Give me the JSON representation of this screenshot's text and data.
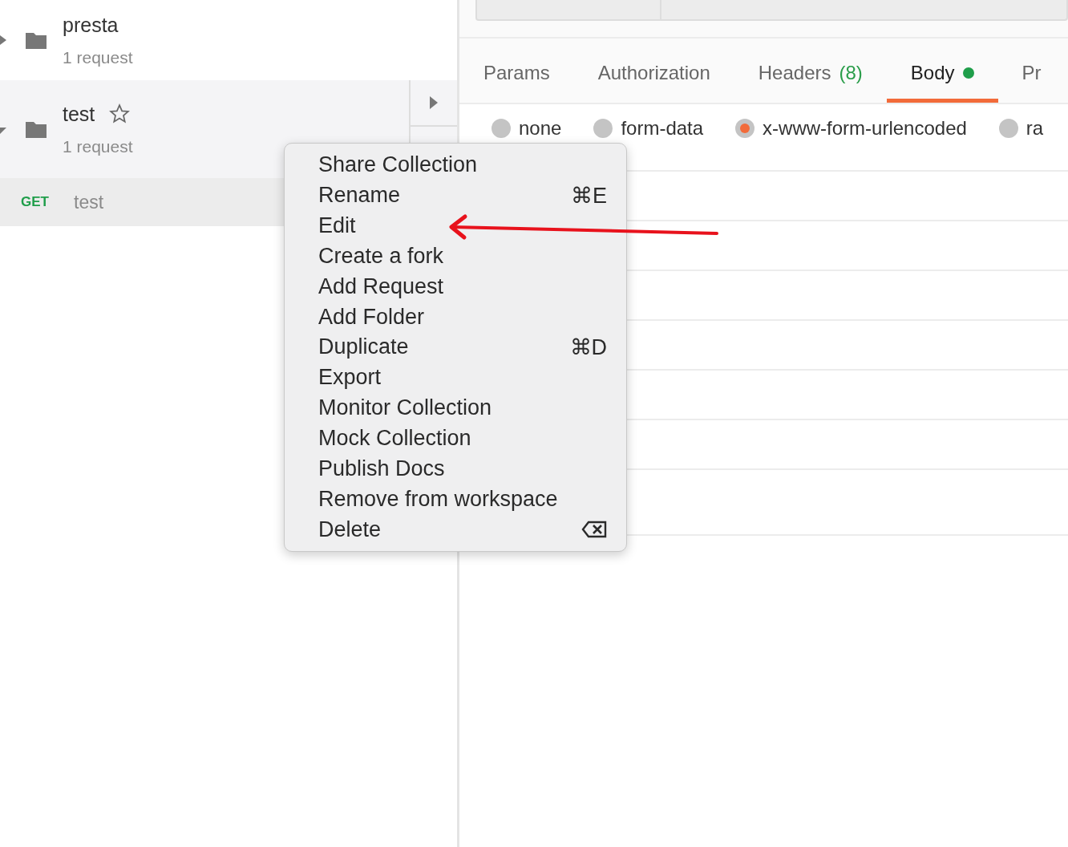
{
  "sidebar": {
    "collections": [
      {
        "name": "presta",
        "count": "1 request",
        "expanded": false,
        "show_star": false
      },
      {
        "name": "test",
        "count": "1 request",
        "expanded": true,
        "show_star": true,
        "children": [
          {
            "method": "GET",
            "name": "test"
          }
        ]
      }
    ]
  },
  "request_tabs": [
    {
      "label": "Params",
      "selected": false
    },
    {
      "label": "Authorization",
      "selected": false
    },
    {
      "label": "Headers",
      "count": "(8)",
      "selected": false
    },
    {
      "label": "Body",
      "selected": true,
      "modified": true
    },
    {
      "label": "Pr",
      "selected": false
    }
  ],
  "body_types": [
    {
      "label": "none",
      "selected": false
    },
    {
      "label": "form-data",
      "selected": false
    },
    {
      "label": "x-www-form-urlencoded",
      "selected": true
    },
    {
      "label": "ra",
      "selected": false
    }
  ],
  "context_menu": [
    {
      "label": "Share Collection",
      "kind": "plain"
    },
    {
      "label": "Rename",
      "kind": "shortcut",
      "shortcut": "⌘E"
    },
    {
      "label": "Edit",
      "kind": "plain"
    },
    {
      "label": "Create a fork",
      "kind": "plain"
    },
    {
      "label": "Add Request",
      "kind": "plain"
    },
    {
      "label": "Add Folder",
      "kind": "plain"
    },
    {
      "label": "Duplicate",
      "kind": "shortcut",
      "shortcut": "⌘D"
    },
    {
      "label": "Export",
      "kind": "plain"
    },
    {
      "label": "Monitor Collection",
      "kind": "plain"
    },
    {
      "label": "Mock Collection",
      "kind": "plain"
    },
    {
      "label": "Publish Docs",
      "kind": "plain"
    },
    {
      "label": "Remove from workspace",
      "kind": "plain"
    },
    {
      "label": "Delete",
      "kind": "backspace"
    }
  ]
}
